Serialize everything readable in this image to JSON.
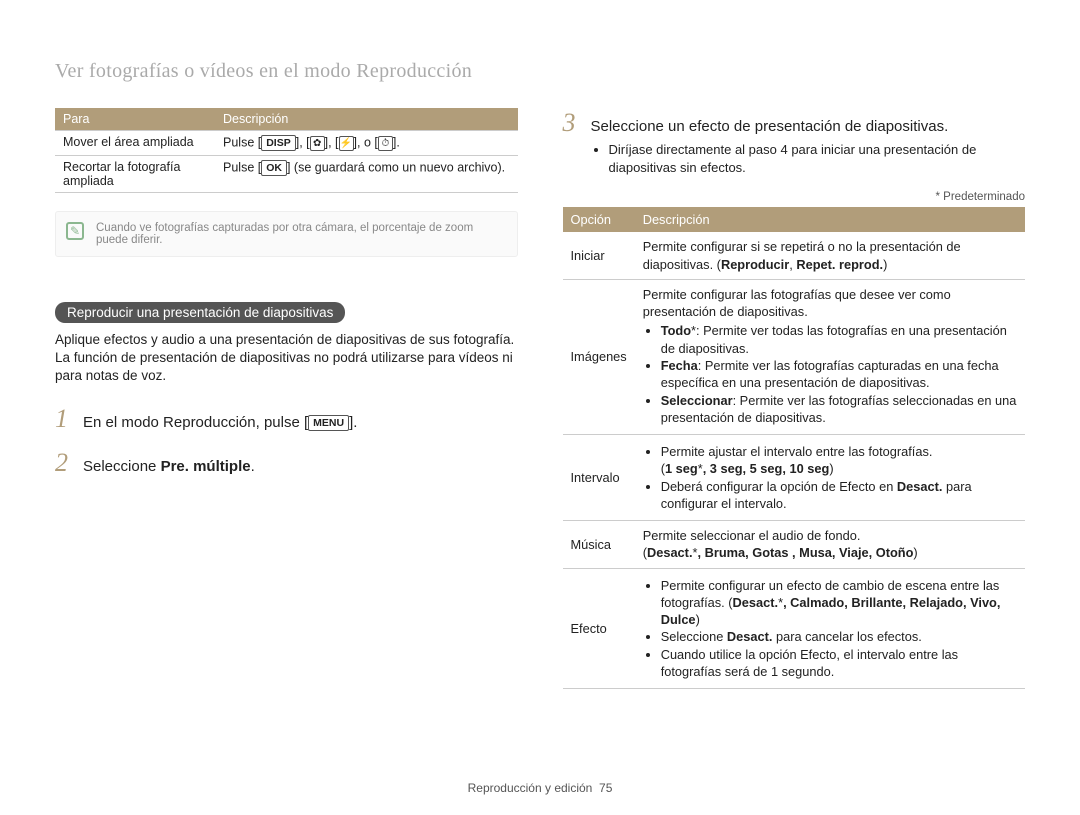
{
  "page_title": "Ver fotografías o vídeos en el modo Reproducción",
  "footer": {
    "text": "Reproducción y edición",
    "page": "75"
  },
  "left": {
    "table1": {
      "headers": [
        "Para",
        "Descripción"
      ],
      "rows": [
        {
          "para": "Mover el área ampliada",
          "desc_pre": "Pulse [",
          "disp": "DISP",
          "sep": "], [",
          "icon1": "✿",
          "icon2": "⚡",
          "o": "], o [",
          "icon3": "⏱",
          "post": "]."
        },
        {
          "para": "Recortar la fotografía ampliada",
          "desc_pre": "Pulse [",
          "ok": "OK",
          "post": "] (se guardará como un nuevo archivo)."
        }
      ]
    },
    "note": "Cuando ve fotografías capturadas por otra cámara, el porcentaje de zoom puede diferir.",
    "section_title": "Reproducir una presentación de diapositivas",
    "section_body": "Aplique efectos y audio a una presentación de diapositivas de sus fotografía. La función de presentación de diapositivas no podrá utilizarse para vídeos ni para notas de voz.",
    "step1": {
      "num": "1",
      "pre": "En el modo Reproducción, pulse [",
      "menu": "MENU",
      "post": "]."
    },
    "step2": {
      "num": "2",
      "pre": "Seleccione ",
      "bold": "Pre. múltiple",
      "post": "."
    }
  },
  "right": {
    "step3": {
      "num": "3",
      "text": "Seleccione un efecto de presentación de diapositivas.",
      "sub": "Diríjase directamente al paso 4 para iniciar una presentación de diapositivas sin efectos."
    },
    "predet": "* Predeterminado",
    "opt_table": {
      "headers": [
        "Opción",
        "Descripción"
      ],
      "rows": {
        "iniciar": {
          "opt": "Iniciar",
          "text_pre": "Permite configurar si se repetirá o no la presentación de diapositivas. (",
          "bold": "Reproducir",
          "sep": ", ",
          "bold2": "Repet. reprod.",
          "post": ")"
        },
        "imagenes": {
          "opt": "Imágenes",
          "intro": "Permite configurar las fotografías que desee ver como presentación de diapositivas.",
          "li1_b": "Todo",
          "li1_star": "*",
          "li1_rest": ": Permite ver todas las fotografías en una presentación de diapositivas.",
          "li2_b": "Fecha",
          "li2_rest": ": Permite ver las fotografías capturadas en una fecha específica en una presentación de diapositivas.",
          "li3_b": "Seleccionar",
          "li3_rest": ": Permite ver las fotografías seleccionadas en una presentación de diapositivas."
        },
        "intervalo": {
          "opt": "Intervalo",
          "li1": "Permite ajustar el intervalo entre las fotografías.",
          "li1_paren_pre": "(",
          "li1_bold": "1 seg",
          "li1_star": "*",
          "li1_rest": ", 3 seg, 5 seg, 10 seg",
          "li1_paren_post": ")",
          "li2_pre": "Deberá configurar la opción de Efecto en ",
          "li2_bold": "Desact.",
          "li2_post": " para configurar el intervalo."
        },
        "musica": {
          "opt": "Música",
          "text": "Permite seleccionar el audio de fondo.",
          "paren_pre": "(",
          "b1": "Desact.",
          "star": "*",
          "rest": ", Bruma, Gotas , Musa, Viaje, Otoño",
          "paren_post": ")"
        },
        "efecto": {
          "opt": "Efecto",
          "li1_pre": "Permite configurar un efecto de cambio de escena entre las fotografías. (",
          "li1_b1": "Desact.",
          "li1_star": "*",
          "li1_rest": ", Calmado, Brillante, Relajado, Vivo, Dulce",
          "li1_post": ")",
          "li2_pre": "Seleccione ",
          "li2_b": "Desact.",
          "li2_post": " para cancelar los efectos.",
          "li3": "Cuando utilice la opción Efecto, el intervalo entre las fotografías será de 1 segundo."
        }
      }
    }
  }
}
